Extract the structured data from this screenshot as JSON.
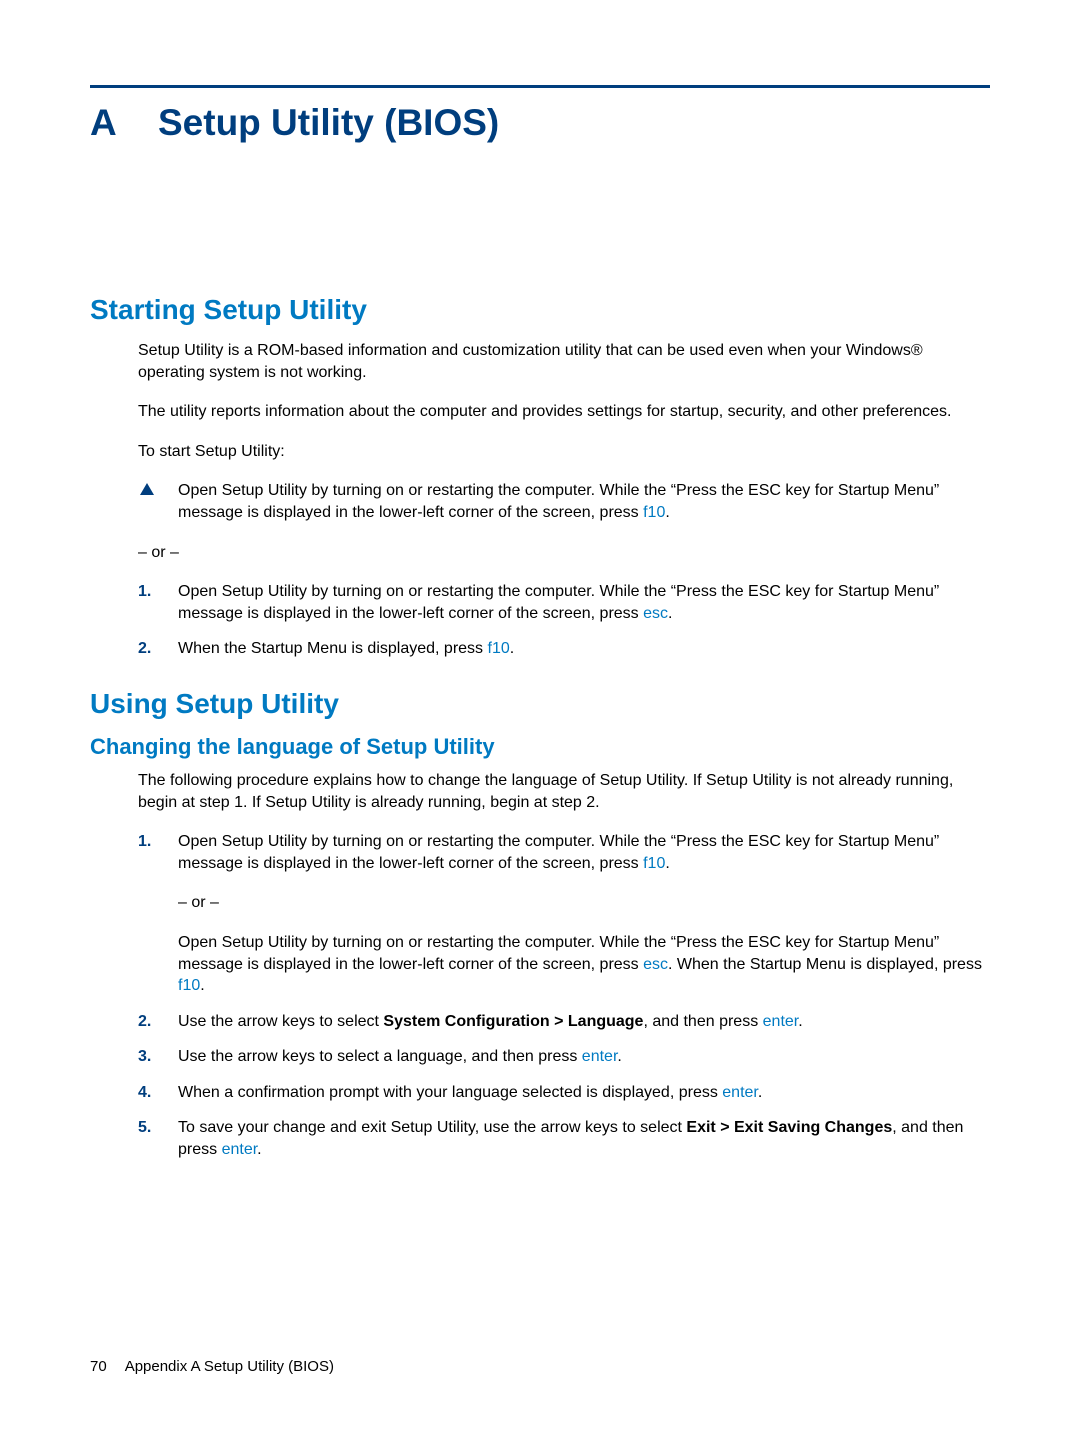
{
  "appendix": {
    "letter": "A",
    "title": "Setup Utility (BIOS)"
  },
  "section1": {
    "heading": "Starting Setup Utility",
    "p1": "Setup Utility is a ROM-based information and customization utility that can be used even when your Windows® operating system is not working.",
    "p2": "The utility reports information about the computer and provides settings for startup, security, and other preferences.",
    "p3": "To start Setup Utility:",
    "bullet1a": "Open Setup Utility by turning on or restarting the computer. While the “Press the ESC key for Startup Menu” message is displayed in the lower-left corner of the screen, press ",
    "bullet1b": ".",
    "or": "– or –",
    "step1a": "Open Setup Utility by turning on or restarting the computer. While the “Press the ESC key for Startup Menu” message is displayed in the lower-left corner of the screen, press ",
    "step1b": ".",
    "step2a": "When the Startup Menu is displayed, press ",
    "step2b": ".",
    "key_f10": "f10",
    "key_esc": "esc"
  },
  "section2": {
    "heading": "Using Setup Utility",
    "sub1": {
      "heading": "Changing the language of Setup Utility",
      "intro": "The following procedure explains how to change the language of Setup Utility. If Setup Utility is not already running, begin at step 1. If Setup Utility is already running, begin at step 2.",
      "s1p1a": "Open Setup Utility by turning on or restarting the computer. While the “Press the ESC key for Startup Menu” message is displayed in the lower-left corner of the screen, press ",
      "s1p1b": ".",
      "s1or": "– or –",
      "s1p2a": "Open Setup Utility by turning on or restarting the computer. While the “Press the ESC key for Startup Menu” message is displayed in the lower-left corner of the screen, press ",
      "s1p2b": ". When the Startup Menu is displayed, press ",
      "s1p2c": ".",
      "s2a": "Use the arrow keys to select ",
      "s2bold": "System Configuration > Language",
      "s2b": ", and then press ",
      "s2c": ".",
      "s3a": "Use the arrow keys to select a language, and then press ",
      "s3b": ".",
      "s4a": "When a confirmation prompt with your language selected is displayed, press ",
      "s4b": ".",
      "s5a": "To save your change and exit Setup Utility, use the arrow keys to select ",
      "s5bold": "Exit > Exit Saving Changes",
      "s5b": ", and then press ",
      "s5c": ".",
      "key_f10": "f10",
      "key_esc": "esc",
      "key_enter": "enter"
    }
  },
  "markers": {
    "n1": "1.",
    "n2": "2.",
    "n3": "3.",
    "n4": "4.",
    "n5": "5."
  },
  "footer": {
    "page": "70",
    "label": "Appendix A   Setup Utility (BIOS)"
  }
}
